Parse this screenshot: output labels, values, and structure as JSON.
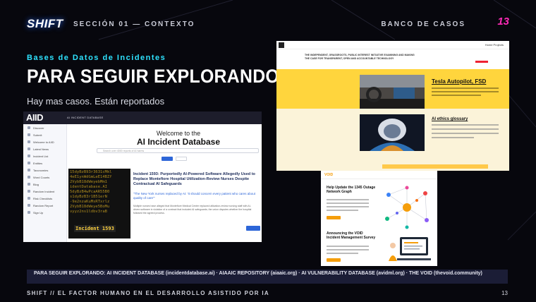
{
  "header": {
    "logo": "SHIFT",
    "section": "SECCIÓN 01 — CONTEXTO",
    "category": "BANCO DE CASOS",
    "page_number": "13"
  },
  "colors": {
    "background": "#07070d",
    "accent_cyan": "#2ee3ff",
    "accent_pink": "#ff2bb8",
    "banner": "#1b1d36"
  },
  "main": {
    "kicker": "Bases de Datos de Incidentes",
    "title": "PARA SEGUIR EXPLORANDO",
    "subtitle": "Hay mas casos. Están reportados"
  },
  "aiid": {
    "logo": "AIID",
    "top_name": "AI INCIDENT DATABASE",
    "sidebar": [
      "Discover",
      "Submit",
      "Welcome to AIID",
      "Latest News",
      "Incident List",
      "Entities",
      "Taxonomies",
      "Word Counts",
      "Blog",
      "Random Incident",
      "Risk Checklists",
      "Random Report",
      "Sign Up"
    ],
    "welcome": "Welcome to the",
    "db_name": "AI Incident Database",
    "search_placeholder": "Search over 4000 reports of AI harms",
    "code_lines": "15dyBzB93r3631cMkl\n4eE1ynWdGmLeE14BZf\n2VybB18dWeyebMm1\nidentDatabase.AI\n5dyBzB4wPcaAR55B0\ns1dyBzB3r1B51erN\n-9e2nzaKuMsRTxrlz\n2VybB18dWeye5BoMu\nvyyz2ns1ldbv3raB",
    "incident_tag": "Incident 1593",
    "card_title": "Incident 1593: Purportedly AI-Powered Software Allegedly Used to Replace Montefiore Hospital Utilization-Review Nurses Despite Contractual AI Safeguards",
    "card_quote": "\"The New York nurses replaced by AI: 'It should concern every patient who cares about quality of care'\"",
    "card_text": "Multiple nurses have alleged that Montefiore Medical Center replaced utilization-review nursing staff with AI-driven software in violation of a contract that included AI safeguards; the union disputes whether the hospital followed the agreed process."
  },
  "aiaaic": {
    "banner_text": "THE INDEPENDENT, GRASSROOTS, PUBLIC INTEREST INITIATIVE EXAMINING AND MAKING THE CASE FOR TRANSPARENT, OPEN AND ACCOUNTABLE TECHNOLOGY",
    "nav": "Home    Projects",
    "feature1": "Tesla Autopilot, FSD",
    "feature2": "AI ethics glossary"
  },
  "void": {
    "logo": "VOID",
    "headline1": "Help Update the 1345 Outage Network Graph",
    "headline2": "Announcing the VOID Incident Management Survey"
  },
  "sources_text": "PARA SEGUIR EXPLORANDO:  AI INCIDENT DATABASE (incidentdatabase.ai)  ·  AIAAIC REPOSITORY (aiaaic.org)  ·  AI VULNERABILITY DATABASE (avidml.org)  ·  THE VOID (thevoid.community)",
  "footer": {
    "left": "SHIFT // EL FACTOR HUMANO EN EL DESARROLLO ASISTIDO POR IA",
    "page": "13"
  }
}
